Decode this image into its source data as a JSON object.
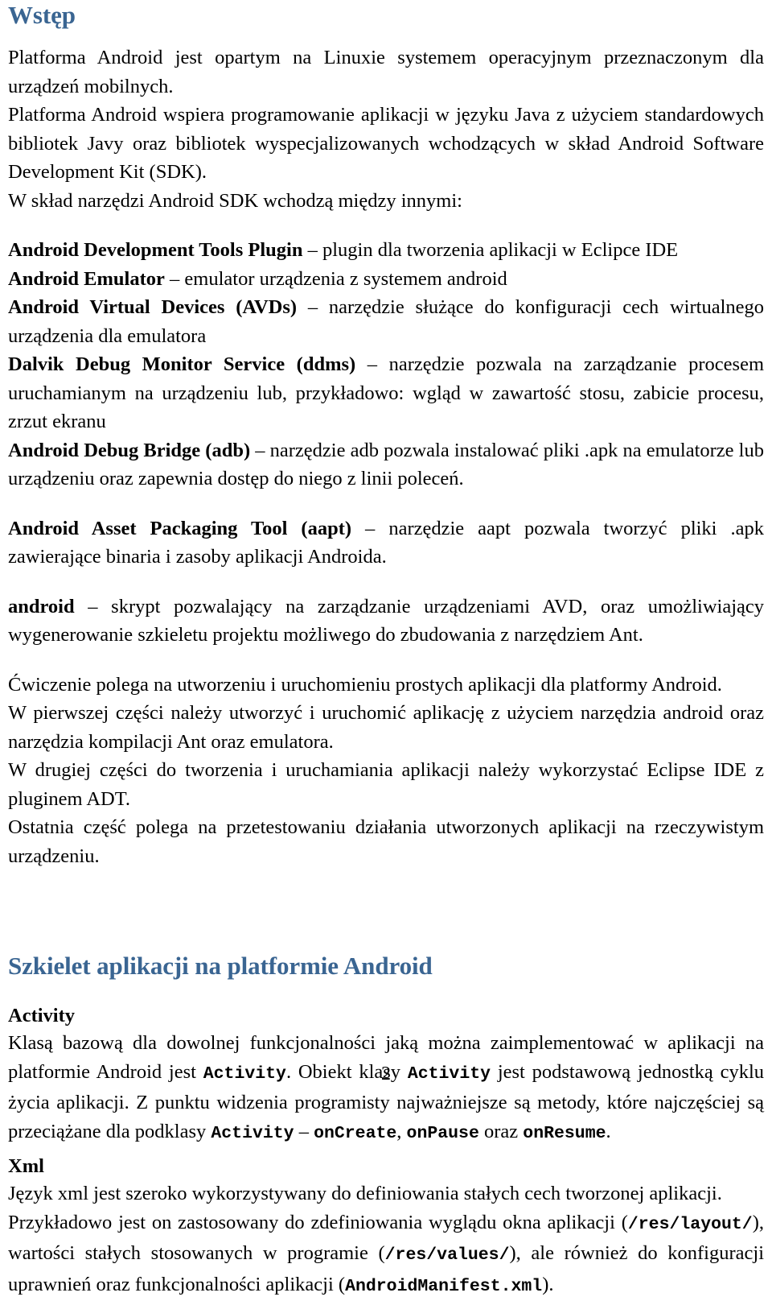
{
  "document": {
    "page_number": "2",
    "heading_color": "#3A6592",
    "text_color": "#000000",
    "background_color": "#FFFFFF"
  },
  "sections": {
    "intro": {
      "heading": "Wstęp",
      "p1": "Platforma Android jest opartym na Linuxie systemem operacyjnym przeznaczonym dla urządzeń mobilnych.",
      "p2": "Platforma Android wspiera programowanie aplikacji w języku Java z użyciem standardowych bibliotek Javy oraz bibliotek wyspecjalizowanych wchodzących w skład Android Software Development Kit (SDK).",
      "p3": "W skład narzędzi Android SDK wchodzą między innymi:"
    },
    "tools": [
      {
        "term": "Android Development Tools Plugin",
        "dash": " – ",
        "desc": "plugin dla tworzenia aplikacji w Eclipce IDE"
      },
      {
        "term": "Android Emulator",
        "dash": " – ",
        "desc": "emulator urządzenia z systemem android"
      },
      {
        "term": "Android Virtual Devices (AVDs)",
        "dash": " – ",
        "desc": "narzędzie służące do konfiguracji cech wirtualnego urządzenia dla emulatora"
      },
      {
        "term": "Dalvik Debug Monitor Service (ddms)",
        "dash": " – ",
        "desc": "narzędzie pozwala na zarządzanie procesem uruchamianym na urządzeniu lub, przykładowo: wgląd w zawartość stosu, zabicie procesu, zrzut ekranu"
      },
      {
        "term": "Android Debug Bridge (adb)",
        "dash": " – ",
        "desc": "narzędzie adb pozwala instalować pliki .apk na emulatorze lub urządzeniu oraz zapewnia dostęp do niego z linii poleceń."
      }
    ],
    "tools_extra": [
      {
        "term": "Android Asset Packaging Tool (aapt)",
        "dash": " – ",
        "desc": "narzędzie aapt pozwala tworzyć pliki .apk zawierające binaria i zasoby aplikacji Androida."
      },
      {
        "term": "android",
        "dash": " – ",
        "desc": "skrypt pozwalający na zarządzanie urządzeniami AVD, oraz umożliwiający wygenerowanie szkieletu projektu możliwego do zbudowania z narzędziem Ant."
      }
    ],
    "exercise": {
      "p1": "Ćwiczenie polega na utworzeniu i uruchomieniu prostych aplikacji dla platformy Android.",
      "p2": "W pierwszej części należy utworzyć i uruchomić aplikację z użyciem narzędzia android oraz narzędzia kompilacji Ant oraz emulatora.",
      "p3": "W drugiej części do tworzenia i uruchamiania aplikacji należy wykorzystać Eclipse IDE z pluginem ADT.",
      "p4": "Ostatnia część polega na przetestowaniu działania utworzonych aplikacji na rzeczywistym urządzeniu."
    },
    "skeleton": {
      "heading": "Szkielet aplikacji na platformie Android",
      "activity": {
        "heading": "Activity",
        "t1": "Klasą bazową dla dowolnej funkcjonalności jaką można zaimplementować w aplikacji na platformie Android jest ",
        "code1": "Activity",
        "t2": ". Obiekt klasy ",
        "code2": "Activity",
        "t3": " jest podstawową jednostką cyklu życia aplikacji. Z punktu widzenia programisty najważniejsze są metody, które najczęściej są przeciążane dla podklasy ",
        "code3": "Activity",
        "t4": " – ",
        "code4": "onCreate",
        "t5": ", ",
        "code5": "onPause",
        "t6": " oraz ",
        "code6": "onResume",
        "t7": "."
      },
      "xml": {
        "heading": "Xml",
        "t1": "Język xml jest szeroko wykorzystywany do definiowania stałych cech tworzonej aplikacji.",
        "t2": "Przykładowo jest on zastosowany do zdefiniowania wyglądu okna aplikacji (",
        "code1": "/res/layout/",
        "t3": "), wartości stałych stosowanych w programie (",
        "code2": "/res/values/",
        "t4": "), ale również do konfiguracji uprawnień oraz funkcjonalności aplikacji (",
        "code3": "AndroidManifest.xml",
        "t5": ")."
      }
    }
  }
}
